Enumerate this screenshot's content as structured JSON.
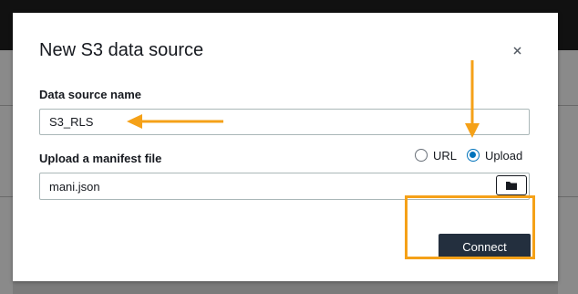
{
  "dialog": {
    "title": "New S3 data source",
    "close_label": "×"
  },
  "fields": {
    "data_source_name": {
      "label": "Data source name",
      "value": "S3_RLS"
    },
    "manifest": {
      "label_prefix": "Upload a ",
      "label_strong": "manifest file",
      "value": "mani.json",
      "options": [
        {
          "label": "URL",
          "checked": false
        },
        {
          "label": "Upload",
          "checked": true
        }
      ]
    }
  },
  "actions": {
    "connect_label": "Connect"
  },
  "colors": {
    "annotation": "#f5a118",
    "primary_button": "#232f3e",
    "radio_selected": "#0073bb"
  },
  "icons": {
    "close": "close-icon",
    "folder": "folder-icon"
  }
}
